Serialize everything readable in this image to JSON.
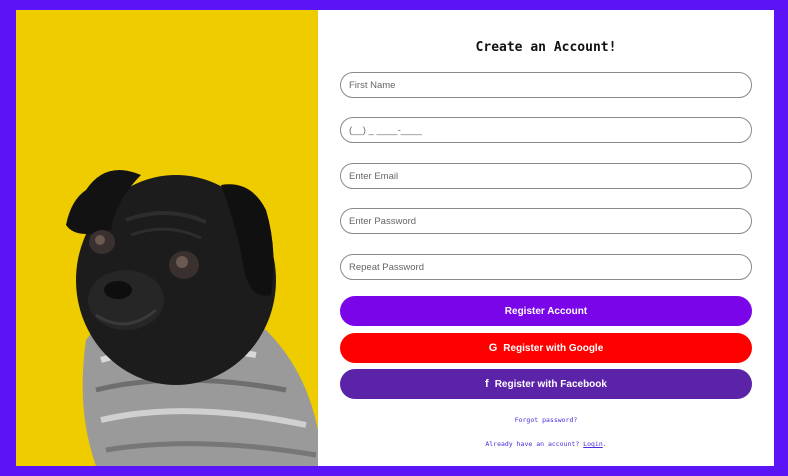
{
  "form": {
    "title": "Create an Account!",
    "fields": {
      "first_name_placeholder": "First Name",
      "phone_placeholder": "(__) _ ____-____",
      "email_placeholder": "Enter Email",
      "password_placeholder": "Enter Password",
      "repeat_password_placeholder": "Repeat Password"
    },
    "buttons": {
      "register": "Register Account",
      "google": "Register with Google",
      "facebook": "Register with Facebook"
    },
    "icons": {
      "google": "G",
      "facebook": "f"
    },
    "links": {
      "forgot_password": "Forgot password?",
      "already_prefix": "Already have an account?",
      "login": "Login",
      "suffix": "."
    }
  },
  "colors": {
    "frame": "#5a14f5",
    "register_button": "#7a05e8",
    "google_button": "#ff0000",
    "facebook_button": "#5b23a8",
    "photo_background": "#efcc00"
  }
}
